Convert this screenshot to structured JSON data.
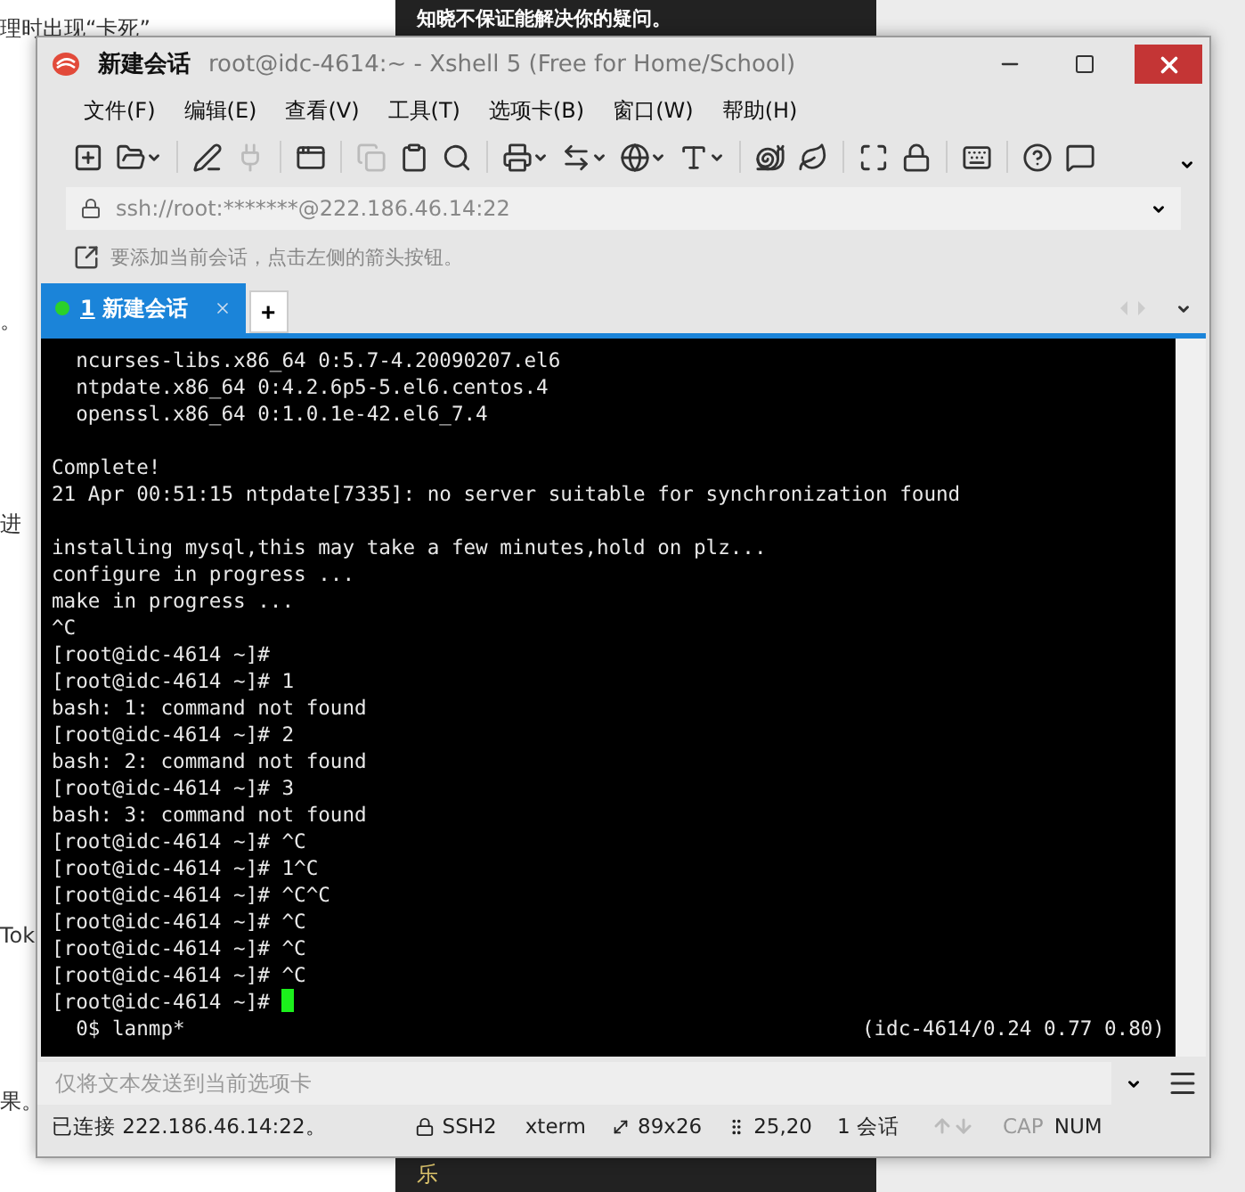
{
  "backdrop": {
    "left_texts": [
      "理时出现“卡死”",
      "。",
      "进",
      "Tok",
      "果。"
    ],
    "panel_top": "知晓不保证能解决你的疑问。",
    "panel_bottom": "乐"
  },
  "window": {
    "session": "新建会话",
    "title": "root@idc-4614:~ - Xshell 5 (Free for Home/School)"
  },
  "menu": [
    "文件(F)",
    "编辑(E)",
    "查看(V)",
    "工具(T)",
    "选项卡(B)",
    "窗口(W)",
    "帮助(H)"
  ],
  "toolbar": [
    [
      {
        "kind": "new",
        "disabled": false,
        "caret": false
      },
      {
        "kind": "open",
        "disabled": false,
        "caret": true
      }
    ],
    [
      {
        "kind": "pen",
        "disabled": false,
        "caret": false
      },
      {
        "kind": "plug",
        "disabled": true,
        "caret": false
      }
    ],
    [
      {
        "kind": "props",
        "disabled": false,
        "caret": false
      }
    ],
    [
      {
        "kind": "copy",
        "disabled": true,
        "caret": false
      },
      {
        "kind": "paste",
        "disabled": false,
        "caret": false
      },
      {
        "kind": "find",
        "disabled": false,
        "caret": false
      }
    ],
    [
      {
        "kind": "print",
        "disabled": false,
        "caret": true
      },
      {
        "kind": "transfer",
        "disabled": false,
        "caret": true
      },
      {
        "kind": "globe",
        "disabled": false,
        "caret": true
      },
      {
        "kind": "font",
        "disabled": false,
        "caret": true
      }
    ],
    [
      {
        "kind": "shell",
        "disabled": false,
        "caret": false
      },
      {
        "kind": "leaf",
        "disabled": false,
        "caret": false
      }
    ],
    [
      {
        "kind": "fullscreen",
        "disabled": false,
        "caret": false
      },
      {
        "kind": "lock",
        "disabled": false,
        "caret": false
      }
    ],
    [
      {
        "kind": "keyboard",
        "disabled": false,
        "caret": false
      }
    ],
    [
      {
        "kind": "help",
        "disabled": false,
        "caret": false
      },
      {
        "kind": "chat",
        "disabled": false,
        "caret": false
      }
    ]
  ],
  "address": "ssh://root:*******@222.186.46.14:22",
  "hint": "要添加当前会话，点击左侧的箭头按钮。",
  "tabs": [
    {
      "number": "1",
      "label": "新建会话",
      "selected": true,
      "connected": true
    }
  ],
  "tab_add": "+",
  "terminal": {
    "blocks": [
      [
        "  ncurses-libs.x86_64 0:5.7-4.20090207.el6",
        "  ntpdate.x86_64 0:4.2.6p5-5.el6.centos.4",
        "  openssl.x86_64 0:1.0.1e-42.el6_7.4"
      ],
      [
        "Complete!",
        "21 Apr 00:51:15 ntpdate[7335]: no server suitable for synchronization found"
      ],
      [
        "installing mysql,this may take a few minutes,hold on plz...",
        "configure in progress ...",
        "make in progress ...",
        "^C",
        "[root@idc-4614 ~]#",
        "[root@idc-4614 ~]# 1",
        "bash: 1: command not found",
        "[root@idc-4614 ~]# 2",
        "bash: 2: command not found",
        "[root@idc-4614 ~]# 3",
        "bash: 3: command not found",
        "[root@idc-4614 ~]# ^C",
        "[root@idc-4614 ~]# 1^C",
        "[root@idc-4614 ~]# ^C^C",
        "[root@idc-4614 ~]# ^C",
        "[root@idc-4614 ~]# ^C",
        "[root@idc-4614 ~]# ^C"
      ]
    ],
    "prompt": "[root@idc-4614 ~]# ",
    "window_list": "  0$ lanmp*",
    "load": "(idc-4614/0.24 0.77 0.80)"
  },
  "send_bar": {
    "placeholder": "仅将文本发送到当前选项卡"
  },
  "status_bar": {
    "connection": "已连接 222.186.46.14:22。",
    "protocol": "SSH2",
    "term": "xterm",
    "size": "89x26",
    "cursor": "25,20",
    "sessions": "1 会话",
    "caps": {
      "label": "CAP",
      "on": false
    },
    "num": {
      "label": "NUM",
      "on": true
    }
  }
}
